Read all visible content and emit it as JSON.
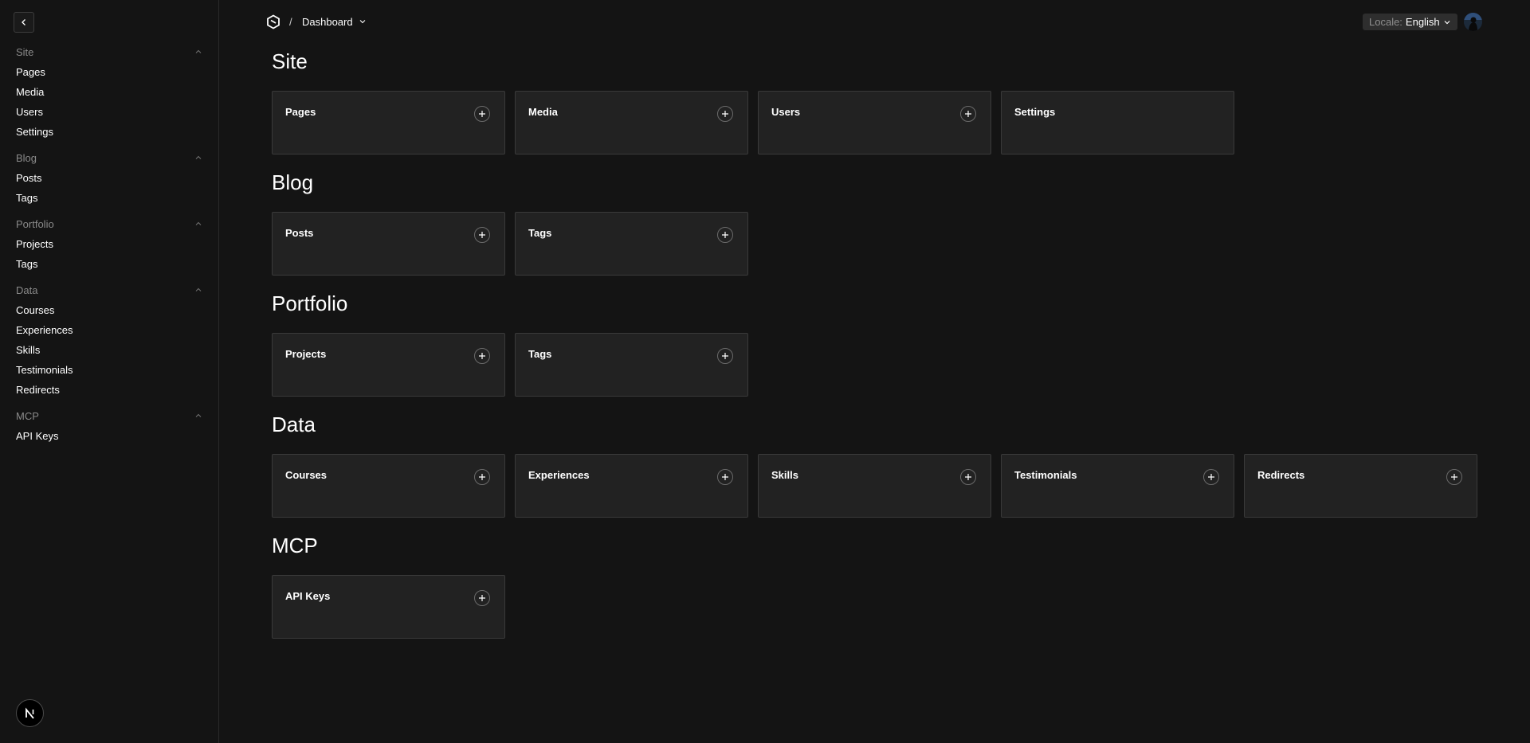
{
  "sidebar": {
    "groups": [
      {
        "label": "Site",
        "items": [
          "Pages",
          "Media",
          "Users",
          "Settings"
        ]
      },
      {
        "label": "Blog",
        "items": [
          "Posts",
          "Tags"
        ]
      },
      {
        "label": "Portfolio",
        "items": [
          "Projects",
          "Tags"
        ]
      },
      {
        "label": "Data",
        "items": [
          "Courses",
          "Experiences",
          "Skills",
          "Testimonials",
          "Redirects"
        ]
      },
      {
        "label": "MCP",
        "items": [
          "API Keys"
        ]
      }
    ]
  },
  "header": {
    "separator": "/",
    "breadcrumb": "Dashboard",
    "locale_label": "Locale:",
    "locale_value": "English"
  },
  "sections": [
    {
      "title": "Site",
      "cards": [
        {
          "title": "Pages",
          "add": true
        },
        {
          "title": "Media",
          "add": true
        },
        {
          "title": "Users",
          "add": true
        },
        {
          "title": "Settings",
          "add": false
        }
      ]
    },
    {
      "title": "Blog",
      "cards": [
        {
          "title": "Posts",
          "add": true
        },
        {
          "title": "Tags",
          "add": true
        }
      ]
    },
    {
      "title": "Portfolio",
      "cards": [
        {
          "title": "Projects",
          "add": true
        },
        {
          "title": "Tags",
          "add": true
        }
      ]
    },
    {
      "title": "Data",
      "cards": [
        {
          "title": "Courses",
          "add": true
        },
        {
          "title": "Experiences",
          "add": true
        },
        {
          "title": "Skills",
          "add": true
        },
        {
          "title": "Testimonials",
          "add": true
        },
        {
          "title": "Redirects",
          "add": true
        }
      ]
    },
    {
      "title": "MCP",
      "cards": [
        {
          "title": "API Keys",
          "add": true
        }
      ]
    }
  ],
  "icons": {
    "collapse": "chevron-left-icon",
    "group_toggle": "chevron-up-icon",
    "brand": "payload-logo-icon",
    "breadcrumb_toggle": "chevron-down-icon",
    "add": "plus-icon",
    "footer_logo": "nextjs-logo-icon"
  },
  "colors": {
    "background": "#141414",
    "card": "#222222",
    "border": "#3a3a3a",
    "muted_text": "#8a8a8a"
  }
}
